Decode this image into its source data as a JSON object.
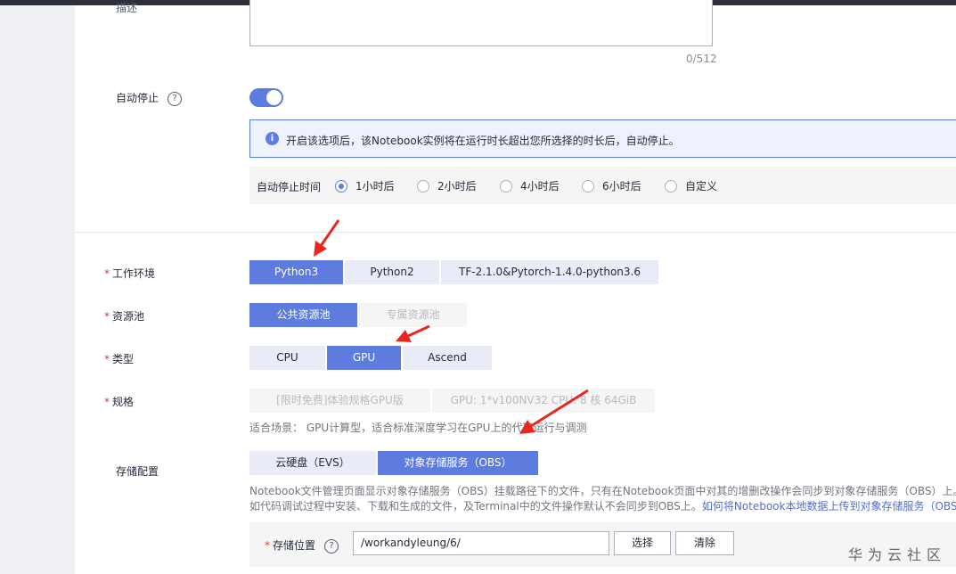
{
  "description": {
    "label": "描述",
    "counter": "0/512"
  },
  "auto_stop": {
    "label": "自动停止",
    "help": "?",
    "enabled": true,
    "notice": "开启该选项后，该Notebook实例将在运行时长超出您所选择的时长后，自动停止。",
    "time_label": "自动停止时间",
    "options": [
      "1小时后",
      "2小时后",
      "4小时后",
      "6小时后",
      "自定义"
    ],
    "selected": "1小时后"
  },
  "work_env": {
    "required": "*",
    "label": "工作环境",
    "options": [
      "Python3",
      "Python2",
      "TF-2.1.0&Pytorch-1.4.0-python3.6"
    ],
    "selected": "Python3"
  },
  "resource_pool": {
    "required": "*",
    "label": "资源池",
    "options": [
      "公共资源池",
      "专属资源池"
    ],
    "selected": "公共资源池"
  },
  "type": {
    "required": "*",
    "label": "类型",
    "options": [
      "CPU",
      "GPU",
      "Ascend"
    ],
    "selected": "GPU"
  },
  "spec": {
    "required": "*",
    "label": "规格",
    "options": [
      "[限时免费]体验规格GPU版",
      "GPU: 1*v100NV32 CPU: 8 核 64GiB"
    ],
    "hint": "适合场景： GPU计算型，适合标准深度学习在GPU上的代码运行与调测"
  },
  "storage": {
    "label": "存储配置",
    "options": [
      "云硬盘（EVS）",
      "对象存储服务（OBS）"
    ],
    "selected": "对象存储服务（OBS）",
    "hint_line1": "Notebook文件管理页面显示对象存储服务（OBS）挂载路径下的文件，只有在Notebook页面中对其的增删改操作会同步到对象存储服务（OBS）上。其",
    "hint_line2": "如代码调试过程中安装、下载和生成的文件，及Terminal中的文件操作默认不会同步到OBS上。",
    "hint_link": "如何将Notebook本地数据上传到对象存储服务（OBS）",
    "location_required": "*",
    "location_label": "存储位置",
    "location_help": "?",
    "location_value": "/workandyleung/6/",
    "select_button": "选择",
    "clear_button": "清除"
  },
  "watermark": "华为云社区",
  "colors": {
    "primary": "#5e7ce0",
    "annotation_arrow": "#e8281e"
  }
}
